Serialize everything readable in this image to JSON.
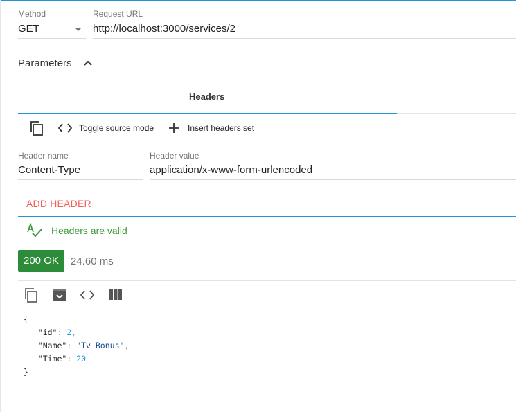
{
  "request": {
    "method_label": "Method",
    "method_value": "GET",
    "url_label": "Request URL",
    "url_value": "http://localhost:3000/services/2"
  },
  "parameters": {
    "label": "Parameters",
    "tabs": [
      {
        "label": "Headers",
        "active": true
      }
    ]
  },
  "headers_toolbar": {
    "toggle_source_label": "Toggle source mode",
    "insert_headers_label": "Insert headers set"
  },
  "header_row": {
    "name_label": "Header name",
    "name_value": "Content-Type",
    "value_label": "Header value",
    "value_value": "application/x-www-form-urlencoded"
  },
  "add_header_label": "ADD HEADER",
  "validation": {
    "text": "Headers are valid"
  },
  "response": {
    "status": "200 OK",
    "timing": "24.60 ms",
    "body": {
      "open": "{",
      "close": "}",
      "fields": [
        {
          "key": "\"id\"",
          "value": "2",
          "type": "number",
          "comma": ","
        },
        {
          "key": "\"Name\"",
          "value": "\"Tv Bonus\"",
          "type": "string",
          "comma": ","
        },
        {
          "key": "\"Time\"",
          "value": "20",
          "type": "number",
          "comma": ""
        }
      ]
    }
  },
  "colors": {
    "accent": "#2196d7",
    "status_ok": "#2d8c39",
    "add_header": "#f25f5c",
    "valid": "#3c9a3c"
  },
  "icons": [
    "chevron-down-icon",
    "chevron-up-icon",
    "copy-icon",
    "code-icon",
    "plus-icon",
    "spellcheck-icon",
    "archive-icon",
    "columns-icon"
  ]
}
